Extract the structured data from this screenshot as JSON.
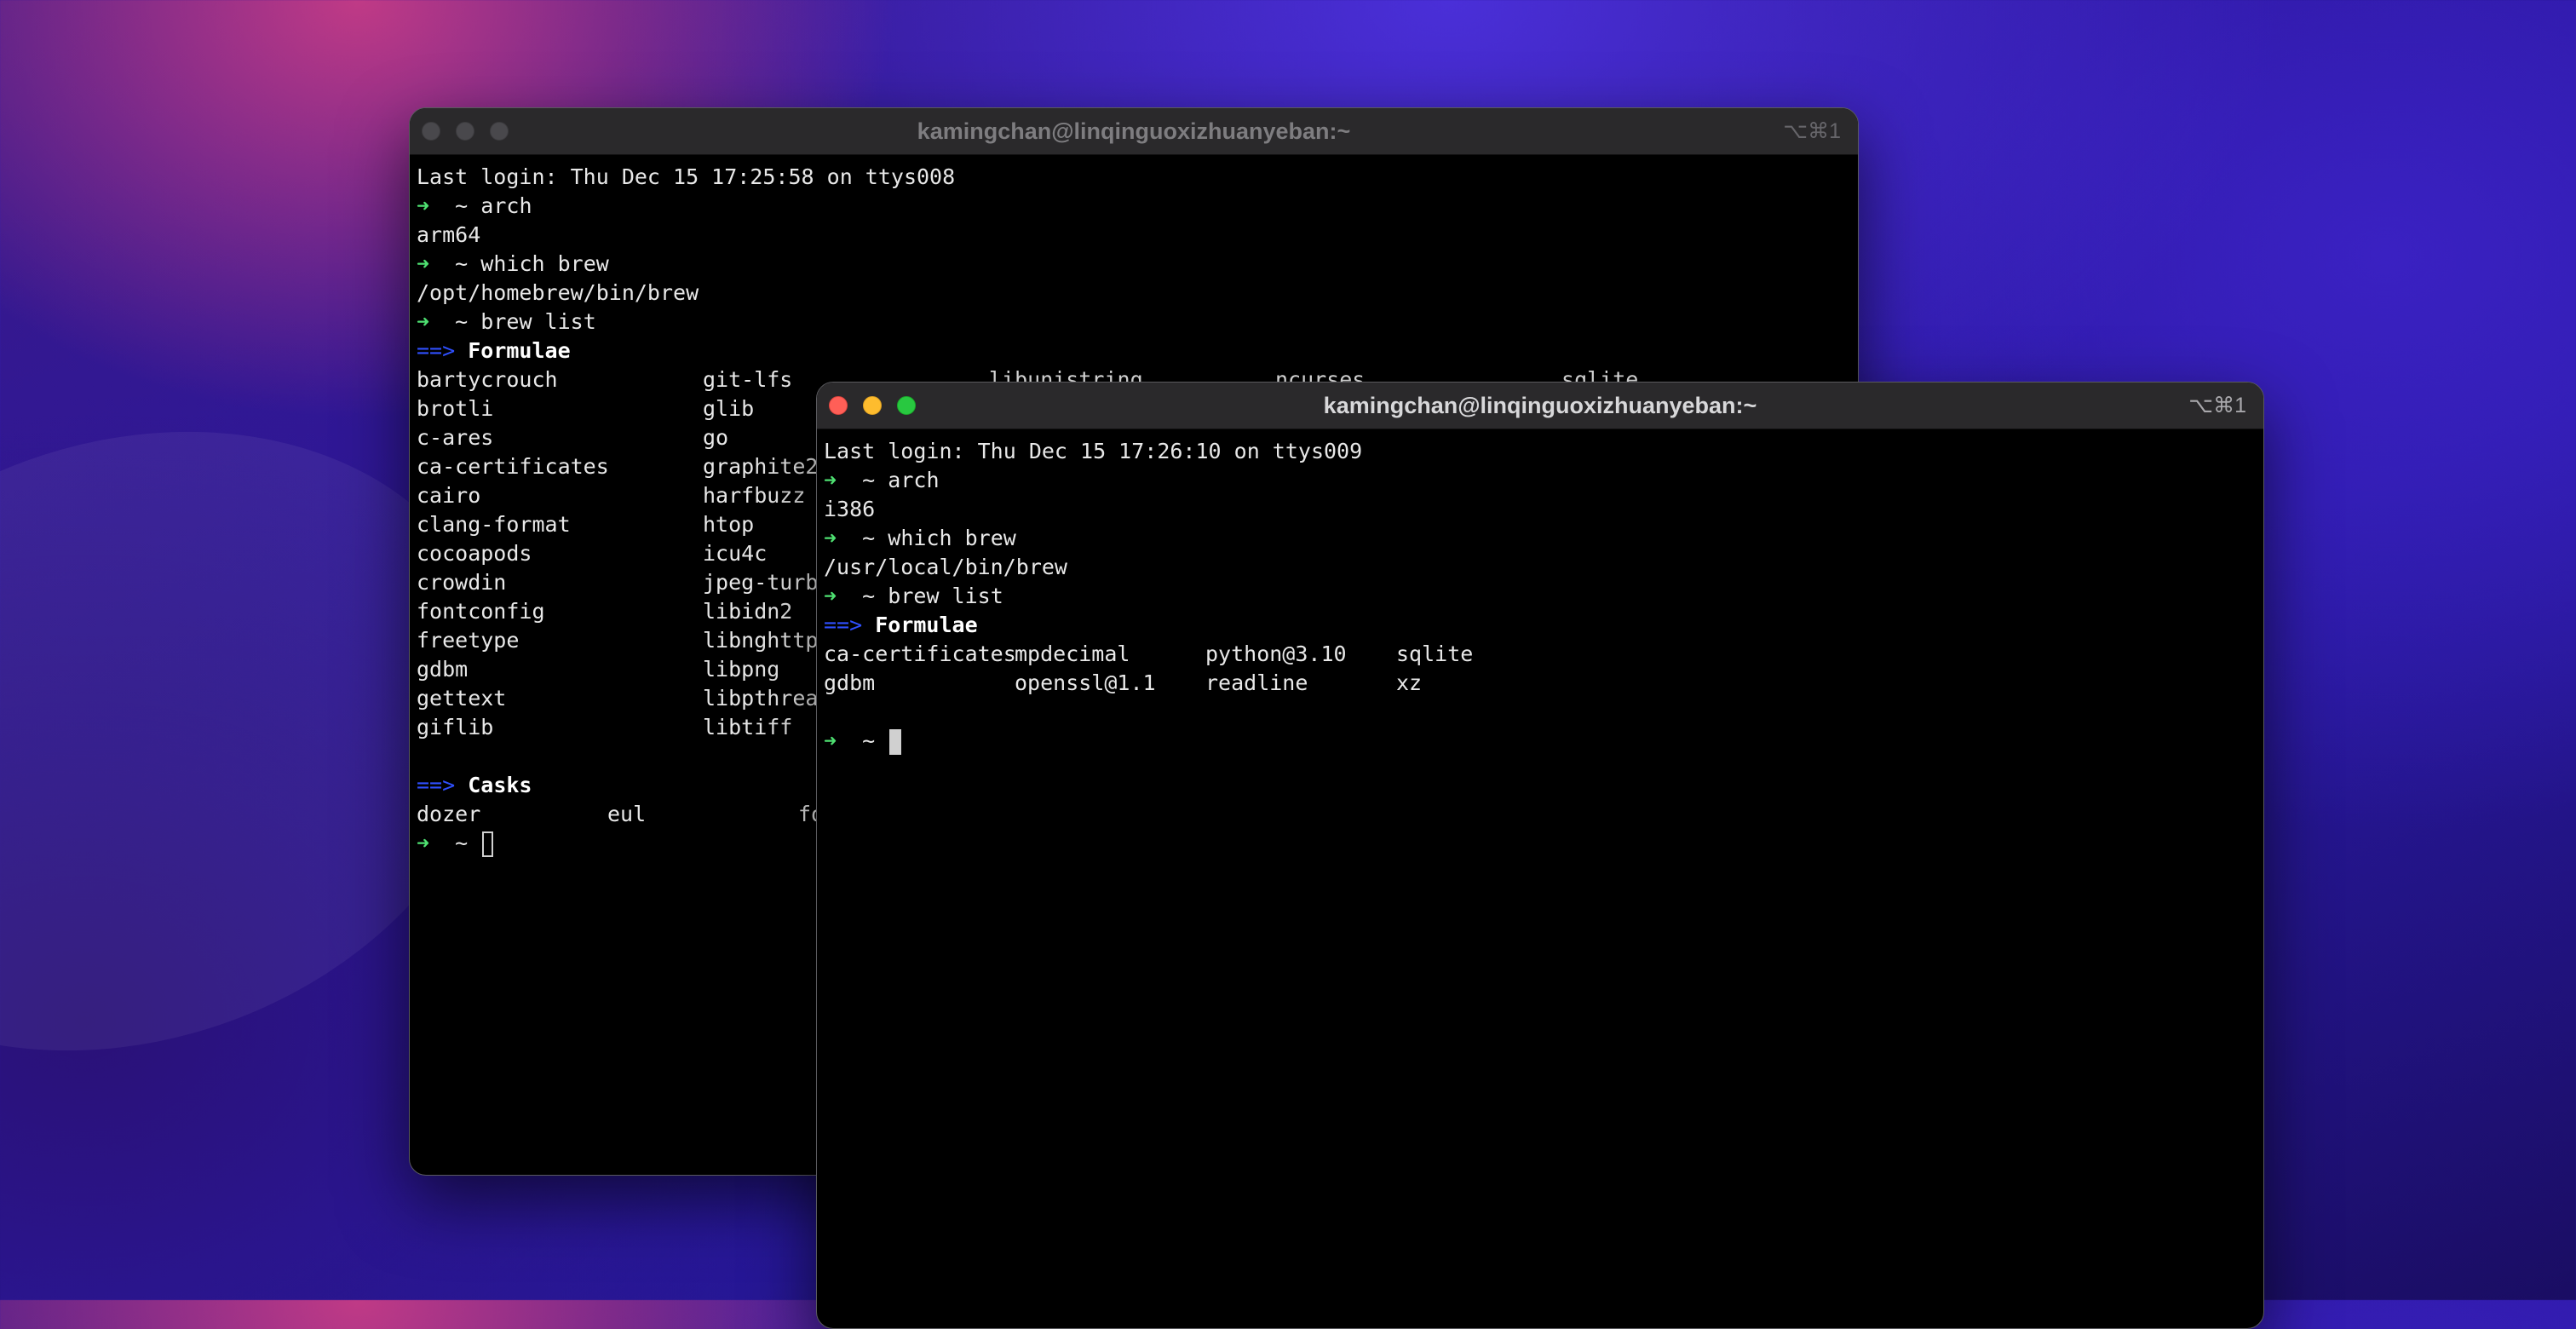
{
  "back_window": {
    "title": "kamingchan@linqinguoxizhuanyeban:~",
    "shortcut": "⌥⌘1",
    "lines": {
      "login": "Last login: Thu Dec 15 17:25:58 on ttys008",
      "cmd_arch": "arch",
      "out_arch": "arm64",
      "cmd_which": "which brew",
      "out_which": "/opt/homebrew/bin/brew",
      "cmd_list": "brew list"
    },
    "prompt_symbol": "➜",
    "prompt_dir": "~",
    "section_arrow": "==>",
    "formulae_header": "Formulae",
    "formulae_rows": [
      [
        "bartycrouch",
        "git-lfs",
        "libunistring",
        "ncurses",
        "sqlite"
      ],
      [
        "brotli",
        "glib"
      ],
      [
        "c-ares",
        "go"
      ],
      [
        "ca-certificates",
        "graphite2"
      ],
      [
        "cairo",
        "harfbuzz"
      ],
      [
        "clang-format",
        "htop"
      ],
      [
        "cocoapods",
        "icu4c"
      ],
      [
        "crowdin",
        "jpeg-turbo"
      ],
      [
        "fontconfig",
        "libidn2"
      ],
      [
        "freetype",
        "libnghttp2"
      ],
      [
        "gdbm",
        "libpng"
      ],
      [
        "gettext",
        "libpthread"
      ],
      [
        "giflib",
        "libtiff"
      ]
    ],
    "casks_header": "Casks",
    "casks_row": [
      "dozer",
      "eul",
      "fo"
    ]
  },
  "front_window": {
    "title": "kamingchan@linqinguoxizhuanyeban:~",
    "shortcut": "⌥⌘1",
    "lines": {
      "login": "Last login: Thu Dec 15 17:26:10 on ttys009",
      "cmd_arch": "arch",
      "out_arch": "i386",
      "cmd_which": "which brew",
      "out_which": "/usr/local/bin/brew",
      "cmd_list": "brew list"
    },
    "prompt_symbol": "➜",
    "prompt_dir": "~",
    "section_arrow": "==>",
    "formulae_header": "Formulae",
    "formulae_rows": [
      [
        "ca-certificates",
        "mpdecimal",
        "python@3.10",
        "sqlite"
      ],
      [
        "gdbm",
        "openssl@1.1",
        "readline",
        "xz"
      ]
    ]
  },
  "colors": {
    "prompt_green": "#4ee071",
    "section_arrow_blue": "#2f50ff",
    "close": "#ff5f57",
    "minimize": "#febc2e",
    "maximize": "#28c840"
  }
}
